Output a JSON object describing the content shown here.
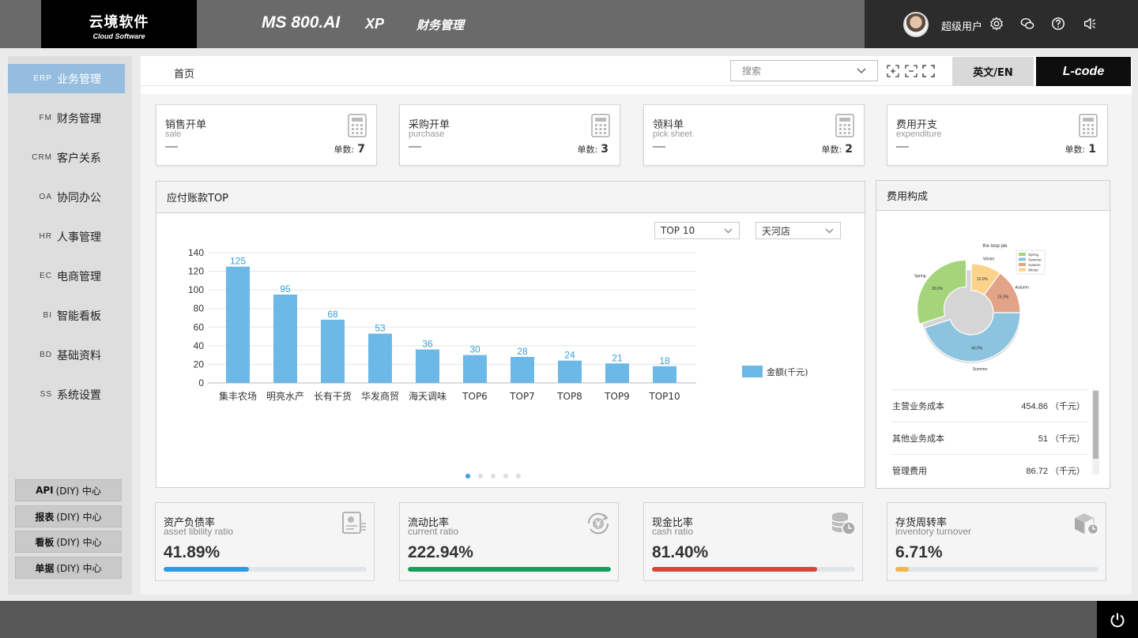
{
  "header": {
    "logo_cn": "云境软件",
    "logo_en": "Cloud Software",
    "product": "MS 800.AI",
    "edition": "XP",
    "module": "财务管理",
    "username": "超级用户",
    "icons": [
      "gear-icon",
      "wechat-icon",
      "help-icon",
      "speaker-icon"
    ]
  },
  "sidebar": {
    "items": [
      {
        "code": "ERP",
        "label": "业务管理",
        "active": true
      },
      {
        "code": "FM",
        "label": "财务管理"
      },
      {
        "code": "CRM",
        "label": "客户关系"
      },
      {
        "code": "OA",
        "label": "协同办公"
      },
      {
        "code": "HR",
        "label": "人事管理"
      },
      {
        "code": "EC",
        "label": "电商管理"
      },
      {
        "code": "BI",
        "label": "智能看板"
      },
      {
        "code": "BD",
        "label": "基础资料"
      },
      {
        "code": "SS",
        "label": "系统设置"
      }
    ],
    "diy": [
      {
        "bold": "API",
        "rest": "(DIY) 中心"
      },
      {
        "bold": "报表",
        "rest": "(DIY) 中心"
      },
      {
        "bold": "看板",
        "rest": "(DIY) 中心"
      },
      {
        "bold": "单据",
        "rest": "(DIY) 中心"
      }
    ]
  },
  "toolbar": {
    "home_tab": "首页",
    "search_placeholder": "搜索",
    "lang_button": "英文/EN",
    "lcode_button": "L-code"
  },
  "doc_cards": [
    {
      "title": "销售开单",
      "subtitle": "sale",
      "dash": "—",
      "count_label": "单数:",
      "count": "7"
    },
    {
      "title": "采购开单",
      "subtitle": "purchase",
      "dash": "—",
      "count_label": "单数:",
      "count": "3"
    },
    {
      "title": "领料单",
      "subtitle": "pick sheet",
      "dash": "—",
      "count_label": "单数:",
      "count": "2"
    },
    {
      "title": "费用开支",
      "subtitle": "expenditure",
      "dash": "—",
      "count_label": "单数:",
      "count": "1"
    }
  ],
  "payables_panel": {
    "title": "应付账款TOP",
    "select_top": "TOP 10",
    "select_store": "天河店"
  },
  "chart_data": {
    "type": "bar",
    "categories": [
      "集丰农场",
      "明亮水产",
      "长有干货",
      "华发商贸",
      "海天调味",
      "TOP6",
      "TOP7",
      "TOP8",
      "TOP9",
      "TOP10"
    ],
    "series": [
      {
        "name": "金额(千元)",
        "values": [
          125,
          95,
          68,
          53,
          36,
          30,
          28,
          24,
          21,
          18
        ]
      }
    ],
    "ylim": [
      0,
      140
    ],
    "yticks": [
      0,
      20,
      40,
      60,
      80,
      100,
      120,
      140
    ],
    "grid": true,
    "legend": "right",
    "color": "#6cb8e6"
  },
  "cost_panel": {
    "title": "费用构成",
    "pie": {
      "title": "the loop pie",
      "slices": [
        {
          "name": "Spring",
          "value": 30.0,
          "color": "#a5d57a"
        },
        {
          "name": "Summer",
          "value": 45.0,
          "color": "#8cc3de"
        },
        {
          "name": "Autumn",
          "value": 15.0,
          "color": "#e2a387"
        },
        {
          "name": "Winter",
          "value": 10.0,
          "color": "#fbd38b"
        }
      ]
    },
    "rows": [
      {
        "label": "主营业务成本",
        "value": "454.86 （千元）"
      },
      {
        "label": "其他业务成本",
        "value": "51 （千元）"
      },
      {
        "label": "管理费用",
        "value": "86.72 （千元）"
      }
    ]
  },
  "ratios": [
    {
      "title": "资产负债率",
      "subtitle": "asset libility ratio",
      "value": "41.89%",
      "fraction": 0.4189,
      "color": "#2b9be8",
      "icon": "receipt-icon"
    },
    {
      "title": "流动比率",
      "subtitle": "current ratio",
      "value": "222.94%",
      "fraction": 1.0,
      "color": "#14a05a",
      "icon": "yen-cycle-icon"
    },
    {
      "title": "现金比率",
      "subtitle": "cash ratio",
      "value": "81.40%",
      "fraction": 0.814,
      "color": "#d9473a",
      "icon": "coins-icon"
    },
    {
      "title": "存货周转率",
      "subtitle": "inventory turnover",
      "value": "6.71%",
      "fraction": 0.0671,
      "color": "#f0b850",
      "icon": "package-icon"
    }
  ]
}
